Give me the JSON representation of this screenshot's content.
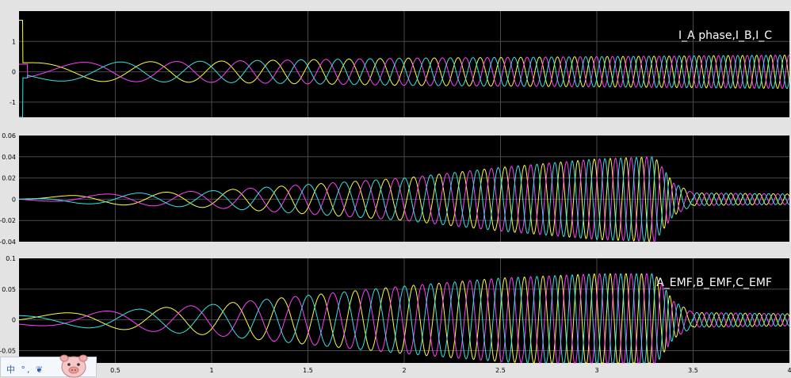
{
  "colors": {
    "background": "#e3e3e3",
    "axes_bg": "#000000",
    "grid": "#4a4a4a",
    "trace_a": "#ffff3c",
    "trace_b": "#ff40ff",
    "trace_c": "#33e5e5"
  },
  "chart_data": [
    {
      "type": "line",
      "title": "I_A phase,I_B,I_C",
      "xlim": [
        0,
        4
      ],
      "ylim": [
        -1.5,
        2
      ],
      "yticks": [
        -1,
        0,
        1
      ],
      "ytick_labels": [
        "-1",
        "0",
        "1"
      ],
      "grid": true,
      "series": [
        {
          "color": "#ffff3c",
          "x": [
            0,
            0.02,
            0.02,
            0.1,
            1,
            2,
            3,
            4
          ],
          "peak": [
            1.7,
            1.7,
            0.3,
            0.3,
            0.35,
            0.45,
            0.5,
            0.55
          ],
          "freq_hz": [
            0,
            0.8,
            3,
            7,
            12,
            14
          ]
        },
        {
          "color": "#ff40ff",
          "x": [
            0,
            0.02,
            0.02,
            0.1,
            1,
            2,
            3,
            4
          ],
          "peak": [
            0.25,
            0.25,
            0.3,
            0.3,
            0.35,
            0.45,
            0.5,
            0.55
          ]
        },
        {
          "color": "#33e5e5",
          "x": [
            0,
            0.02,
            0.02,
            0.1,
            1,
            2,
            3,
            4
          ],
          "peak": [
            -1.75,
            -1.75,
            0.3,
            0.3,
            0.35,
            0.45,
            0.5,
            0.55
          ]
        }
      ]
    },
    {
      "type": "line",
      "title": "",
      "xlim": [
        0,
        4
      ],
      "ylim": [
        -0.04,
        0.06
      ],
      "yticks": [
        -0.04,
        -0.02,
        0,
        0.02,
        0.04,
        0.06
      ],
      "ytick_labels": [
        "-0.04",
        "-0.02",
        "0",
        "0.02",
        "0.04",
        "0.06"
      ],
      "grid": true,
      "envelope": {
        "x": [
          0,
          0.3,
          1,
          2,
          2.5,
          3,
          3.3,
          3.4,
          3.5,
          4
        ],
        "amplitude": [
          0,
          0.004,
          0.008,
          0.02,
          0.03,
          0.038,
          0.04,
          0.015,
          0.006,
          0.005
        ]
      },
      "series": [
        {
          "color": "#ffff3c"
        },
        {
          "color": "#ff40ff"
        },
        {
          "color": "#33e5e5"
        }
      ]
    },
    {
      "type": "line",
      "title": "A_EMF,B_EMF,C_EMF",
      "xlim": [
        0,
        4
      ],
      "ylim": [
        -0.07,
        0.1
      ],
      "yticks": [
        -0.05,
        0,
        0.05,
        0.1
      ],
      "ytick_labels": [
        "-0.05",
        "0",
        "0.05",
        "0.1"
      ],
      "xticks": [
        0.5,
        1,
        1.5,
        2,
        2.5,
        3,
        3.5,
        4
      ],
      "xtick_labels": [
        "0.5",
        "1",
        "1.5",
        "2",
        "2.5",
        "3",
        "3.5",
        "4"
      ],
      "grid": true,
      "envelope": {
        "x": [
          0,
          0.5,
          1,
          1.5,
          2,
          2.5,
          3,
          3.3,
          3.4,
          3.5,
          4
        ],
        "amplitude": [
          0.008,
          0.015,
          0.025,
          0.04,
          0.055,
          0.068,
          0.075,
          0.075,
          0.03,
          0.012,
          0.01
        ]
      },
      "series": [
        {
          "color": "#ffff3c"
        },
        {
          "color": "#ff40ff"
        },
        {
          "color": "#33e5e5"
        }
      ]
    }
  ],
  "ime_toolbar": {
    "text": "中 °, ❦",
    "icon": "pig-mascot-icon"
  }
}
